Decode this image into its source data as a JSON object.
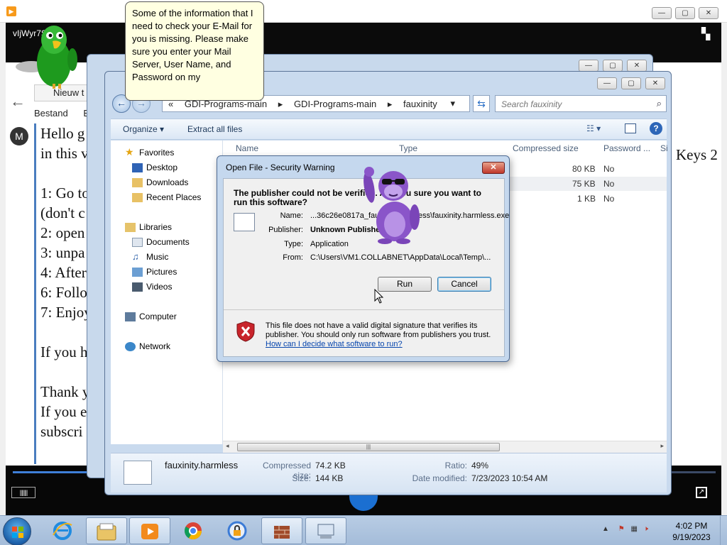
{
  "player": {
    "title_short": "vIjWyr7S",
    "progress_fraction": 0.18,
    "volume_icon": "volume-bars-icon"
  },
  "word": {
    "tab_label": "Nieuw t",
    "menu_bestand": "Bestand",
    "menu_b": "B",
    "doc_lines": [
      "Hello g",
      "in this v",
      "",
      "1: Go to",
      "(don't c",
      "2: open",
      "3: unpa",
      "4: After",
      "6: Follo",
      "7: Enjoy",
      "",
      "If you h",
      "",
      "Thank y",
      "If you e",
      "subscri"
    ],
    "keys_fragment": "Keys 2"
  },
  "balloon": {
    "text": "Some of the information that I need to check your E-Mail for you is missing. Please make sure you enter your Mail Server, User Name, and Password on my"
  },
  "explorer": {
    "breadcrumb": [
      "GDI-Programs-main",
      "GDI-Programs-main",
      "fauxinity"
    ],
    "breadcrumb_prefix": "«",
    "search_placeholder": "Search fauxinity",
    "toolbar": {
      "organize": "Organize ▾",
      "extract": "Extract all files"
    },
    "nav": {
      "favorites": "Favorites",
      "desktop": "Desktop",
      "downloads": "Downloads",
      "recent": "Recent Places",
      "libraries": "Libraries",
      "documents": "Documents",
      "music": "Music",
      "pictures": "Pictures",
      "videos": "Videos",
      "computer": "Computer",
      "network": "Network"
    },
    "columns": {
      "name": "Name",
      "type": "Type",
      "compressed": "Compressed size",
      "password": "Password ...",
      "size": "Si"
    },
    "rows": [
      {
        "compressed": "80 KB",
        "password": "No"
      },
      {
        "compressed": "75 KB",
        "password": "No"
      },
      {
        "compressed": "1 KB",
        "password": "No"
      }
    ],
    "details": {
      "filename": "fauxinity.harmless",
      "compressed_label": "Compressed size:",
      "compressed_value": "74.2 KB",
      "size_label": "Size:",
      "size_value": "144 KB",
      "ratio_label": "Ratio:",
      "ratio_value": "49%",
      "modified_label": "Date modified:",
      "modified_value": "7/23/2023 10:54 AM"
    }
  },
  "dialog": {
    "title": "Open File - Security Warning",
    "question": "The publisher could not be verified. Are you sure you want to run this software?",
    "name_label": "Name:",
    "name_value": "...36c26e0817a_fauxinity.harmless\\fauxinity.harmless.exe",
    "publisher_label": "Publisher:",
    "publisher_value": "Unknown Publisher",
    "type_label": "Type:",
    "type_value": "Application",
    "from_label": "From:",
    "from_value": "C:\\Users\\VM1.COLLABNET\\AppData\\Local\\Temp\\...",
    "run_label": "Run",
    "cancel_label": "Cancel",
    "warning_text": "This file does not have a valid digital signature that verifies its publisher.  You should only run software from publishers you trust.",
    "warning_link": "How can I decide what software to run?"
  },
  "taskbar": {
    "time": "4:02 PM",
    "date": "9/19/2023",
    "tray_arrow": "▲"
  },
  "colors": {
    "accent_blue": "#2d66b8",
    "dialog_close_red": "#c0382b",
    "link_blue": "#0645ad",
    "balloon_bg": "#ffffe1"
  }
}
